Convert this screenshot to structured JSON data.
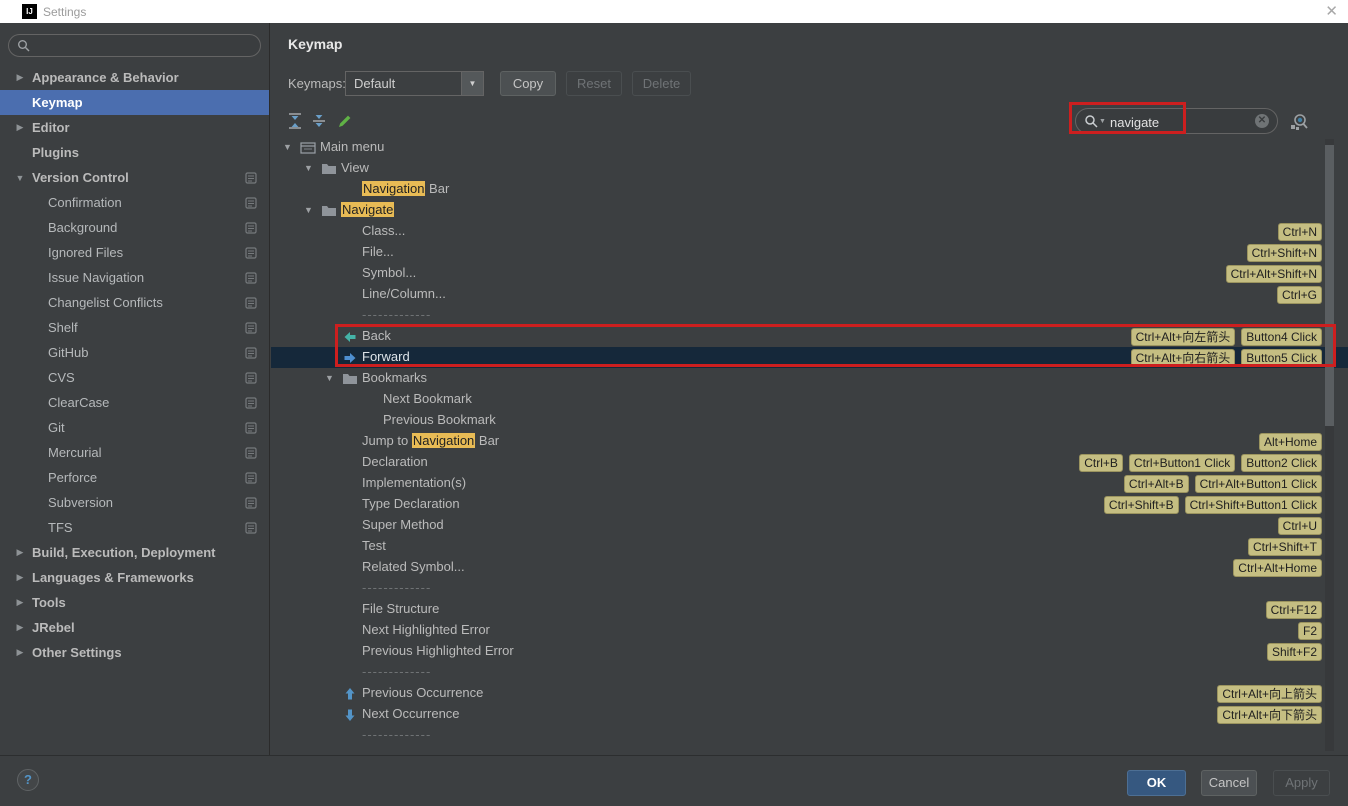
{
  "window": {
    "title": "Settings",
    "close_glyph": "✕",
    "logo_text": "IJ"
  },
  "sidebar": {
    "search_value": "",
    "items": [
      {
        "label": "Appearance & Behavior",
        "level": 0,
        "bold": true,
        "expander": "collapsed",
        "selected": false,
        "badge": false
      },
      {
        "label": "Keymap",
        "level": 0,
        "bold": true,
        "expander": null,
        "selected": true,
        "badge": false
      },
      {
        "label": "Editor",
        "level": 0,
        "bold": true,
        "expander": "collapsed",
        "selected": false,
        "badge": false
      },
      {
        "label": "Plugins",
        "level": 0,
        "bold": true,
        "expander": null,
        "selected": false,
        "badge": false
      },
      {
        "label": "Version Control",
        "level": 0,
        "bold": true,
        "expander": "expanded",
        "selected": false,
        "badge": true
      },
      {
        "label": "Confirmation",
        "level": 1,
        "bold": false,
        "expander": null,
        "selected": false,
        "badge": true
      },
      {
        "label": "Background",
        "level": 1,
        "bold": false,
        "expander": null,
        "selected": false,
        "badge": true
      },
      {
        "label": "Ignored Files",
        "level": 1,
        "bold": false,
        "expander": null,
        "selected": false,
        "badge": true
      },
      {
        "label": "Issue Navigation",
        "level": 1,
        "bold": false,
        "expander": null,
        "selected": false,
        "badge": true
      },
      {
        "label": "Changelist Conflicts",
        "level": 1,
        "bold": false,
        "expander": null,
        "selected": false,
        "badge": true
      },
      {
        "label": "Shelf",
        "level": 1,
        "bold": false,
        "expander": null,
        "selected": false,
        "badge": true
      },
      {
        "label": "GitHub",
        "level": 1,
        "bold": false,
        "expander": null,
        "selected": false,
        "badge": true
      },
      {
        "label": "CVS",
        "level": 1,
        "bold": false,
        "expander": null,
        "selected": false,
        "badge": true
      },
      {
        "label": "ClearCase",
        "level": 1,
        "bold": false,
        "expander": null,
        "selected": false,
        "badge": true
      },
      {
        "label": "Git",
        "level": 1,
        "bold": false,
        "expander": null,
        "selected": false,
        "badge": true
      },
      {
        "label": "Mercurial",
        "level": 1,
        "bold": false,
        "expander": null,
        "selected": false,
        "badge": true
      },
      {
        "label": "Perforce",
        "level": 1,
        "bold": false,
        "expander": null,
        "selected": false,
        "badge": true
      },
      {
        "label": "Subversion",
        "level": 1,
        "bold": false,
        "expander": null,
        "selected": false,
        "badge": true
      },
      {
        "label": "TFS",
        "level": 1,
        "bold": false,
        "expander": null,
        "selected": false,
        "badge": true
      },
      {
        "label": "Build, Execution, Deployment",
        "level": 0,
        "bold": true,
        "expander": "collapsed",
        "selected": false,
        "badge": false
      },
      {
        "label": "Languages & Frameworks",
        "level": 0,
        "bold": true,
        "expander": "collapsed",
        "selected": false,
        "badge": false
      },
      {
        "label": "Tools",
        "level": 0,
        "bold": true,
        "expander": "collapsed",
        "selected": false,
        "badge": false
      },
      {
        "label": "JRebel",
        "level": 0,
        "bold": true,
        "expander": "collapsed",
        "selected": false,
        "badge": false
      },
      {
        "label": "Other Settings",
        "level": 0,
        "bold": true,
        "expander": "collapsed",
        "selected": false,
        "badge": false
      }
    ]
  },
  "header": {
    "title": "Keymap",
    "keymaps_label": "Keymaps:",
    "keymap_value": "Default",
    "copy_label": "Copy",
    "reset_label": "Reset",
    "delete_label": "Delete"
  },
  "toolbar": {
    "search_value": "navigate"
  },
  "tree": {
    "rows": [
      {
        "t": "row",
        "level": 0,
        "expander": true,
        "icon": "menu",
        "parts": [
          {
            "text": "Main menu",
            "hl": false
          }
        ],
        "shortcuts": [],
        "selected": false
      },
      {
        "t": "row",
        "level": 1,
        "expander": true,
        "icon": "folder",
        "parts": [
          {
            "text": "View",
            "hl": false
          }
        ],
        "shortcuts": [],
        "selected": false
      },
      {
        "t": "row",
        "level": 2,
        "expander": false,
        "icon": null,
        "parts": [
          {
            "text": "Navigation",
            "hl": true
          },
          {
            "text": " Bar",
            "hl": false
          }
        ],
        "shortcuts": [],
        "selected": false
      },
      {
        "t": "row",
        "level": 1,
        "expander": true,
        "icon": "folder",
        "parts": [
          {
            "text": "Navigate",
            "hl": true
          }
        ],
        "shortcuts": [],
        "selected": false
      },
      {
        "t": "row",
        "level": 2,
        "expander": false,
        "icon": null,
        "parts": [
          {
            "text": "Class...",
            "hl": false
          }
        ],
        "shortcuts": [
          "Ctrl+N"
        ],
        "selected": false
      },
      {
        "t": "row",
        "level": 2,
        "expander": false,
        "icon": null,
        "parts": [
          {
            "text": "File...",
            "hl": false
          }
        ],
        "shortcuts": [
          "Ctrl+Shift+N"
        ],
        "selected": false
      },
      {
        "t": "row",
        "level": 2,
        "expander": false,
        "icon": null,
        "parts": [
          {
            "text": "Symbol...",
            "hl": false
          }
        ],
        "shortcuts": [
          "Ctrl+Alt+Shift+N"
        ],
        "selected": false
      },
      {
        "t": "row",
        "level": 2,
        "expander": false,
        "icon": null,
        "parts": [
          {
            "text": "Line/Column...",
            "hl": false
          }
        ],
        "shortcuts": [
          "Ctrl+G"
        ],
        "selected": false
      },
      {
        "t": "sep",
        "level": 2
      },
      {
        "t": "row",
        "level": 2,
        "expander": false,
        "icon": "back",
        "parts": [
          {
            "text": "Back",
            "hl": false
          }
        ],
        "shortcuts": [
          "Ctrl+Alt+向左箭头",
          "Button4 Click"
        ],
        "selected": false
      },
      {
        "t": "row",
        "level": 2,
        "expander": false,
        "icon": "forward",
        "parts": [
          {
            "text": "Forward",
            "hl": false
          }
        ],
        "shortcuts": [
          "Ctrl+Alt+向右箭头",
          "Button5 Click"
        ],
        "selected": true
      },
      {
        "t": "row",
        "level": 2,
        "expander": true,
        "icon": "folder",
        "parts": [
          {
            "text": "Bookmarks",
            "hl": false
          }
        ],
        "shortcuts": [],
        "selected": false
      },
      {
        "t": "row",
        "level": 3,
        "expander": false,
        "icon": null,
        "parts": [
          {
            "text": "Next Bookmark",
            "hl": false
          }
        ],
        "shortcuts": [],
        "selected": false
      },
      {
        "t": "row",
        "level": 3,
        "expander": false,
        "icon": null,
        "parts": [
          {
            "text": "Previous Bookmark",
            "hl": false
          }
        ],
        "shortcuts": [],
        "selected": false
      },
      {
        "t": "row",
        "level": 2,
        "expander": false,
        "icon": null,
        "parts": [
          {
            "text": "Jump to ",
            "hl": false
          },
          {
            "text": "Navigation",
            "hl": true
          },
          {
            "text": " Bar",
            "hl": false
          }
        ],
        "shortcuts": [
          "Alt+Home"
        ],
        "selected": false
      },
      {
        "t": "row",
        "level": 2,
        "expander": false,
        "icon": null,
        "parts": [
          {
            "text": "Declaration",
            "hl": false
          }
        ],
        "shortcuts": [
          "Ctrl+B",
          "Ctrl+Button1 Click",
          "Button2 Click"
        ],
        "selected": false
      },
      {
        "t": "row",
        "level": 2,
        "expander": false,
        "icon": null,
        "parts": [
          {
            "text": "Implementation(s)",
            "hl": false
          }
        ],
        "shortcuts": [
          "Ctrl+Alt+B",
          "Ctrl+Alt+Button1 Click"
        ],
        "selected": false
      },
      {
        "t": "row",
        "level": 2,
        "expander": false,
        "icon": null,
        "parts": [
          {
            "text": "Type Declaration",
            "hl": false
          }
        ],
        "shortcuts": [
          "Ctrl+Shift+B",
          "Ctrl+Shift+Button1 Click"
        ],
        "selected": false
      },
      {
        "t": "row",
        "level": 2,
        "expander": false,
        "icon": null,
        "parts": [
          {
            "text": "Super Method",
            "hl": false
          }
        ],
        "shortcuts": [
          "Ctrl+U"
        ],
        "selected": false
      },
      {
        "t": "row",
        "level": 2,
        "expander": false,
        "icon": null,
        "parts": [
          {
            "text": "Test",
            "hl": false
          }
        ],
        "shortcuts": [
          "Ctrl+Shift+T"
        ],
        "selected": false
      },
      {
        "t": "row",
        "level": 2,
        "expander": false,
        "icon": null,
        "parts": [
          {
            "text": "Related Symbol...",
            "hl": false
          }
        ],
        "shortcuts": [
          "Ctrl+Alt+Home"
        ],
        "selected": false
      },
      {
        "t": "sep",
        "level": 2
      },
      {
        "t": "row",
        "level": 2,
        "expander": false,
        "icon": null,
        "parts": [
          {
            "text": "File Structure",
            "hl": false
          }
        ],
        "shortcuts": [
          "Ctrl+F12"
        ],
        "selected": false
      },
      {
        "t": "row",
        "level": 2,
        "expander": false,
        "icon": null,
        "parts": [
          {
            "text": "Next Highlighted Error",
            "hl": false
          }
        ],
        "shortcuts": [
          "F2"
        ],
        "selected": false
      },
      {
        "t": "row",
        "level": 2,
        "expander": false,
        "icon": null,
        "parts": [
          {
            "text": "Previous Highlighted Error",
            "hl": false
          }
        ],
        "shortcuts": [
          "Shift+F2"
        ],
        "selected": false
      },
      {
        "t": "sep",
        "level": 2
      },
      {
        "t": "row",
        "level": 2,
        "expander": false,
        "icon": "up",
        "parts": [
          {
            "text": "Previous Occurrence",
            "hl": false
          }
        ],
        "shortcuts": [
          "Ctrl+Alt+向上箭头"
        ],
        "selected": false
      },
      {
        "t": "row",
        "level": 2,
        "expander": false,
        "icon": "down",
        "parts": [
          {
            "text": "Next Occurrence",
            "hl": false
          }
        ],
        "shortcuts": [
          "Ctrl+Alt+向下箭头"
        ],
        "selected": false
      },
      {
        "t": "sep",
        "level": 2
      }
    ]
  },
  "footer": {
    "help_glyph": "?",
    "ok_label": "OK",
    "cancel_label": "Cancel",
    "apply_label": "Apply"
  },
  "colors": {
    "selection_blue": "#4b6eaf",
    "tree_selection": "#15283a",
    "shortcut_badge": "#c5be82",
    "search_highlight": "#e8bb55",
    "annotation_red": "#cd1f1f",
    "ok_button": "#365880"
  }
}
